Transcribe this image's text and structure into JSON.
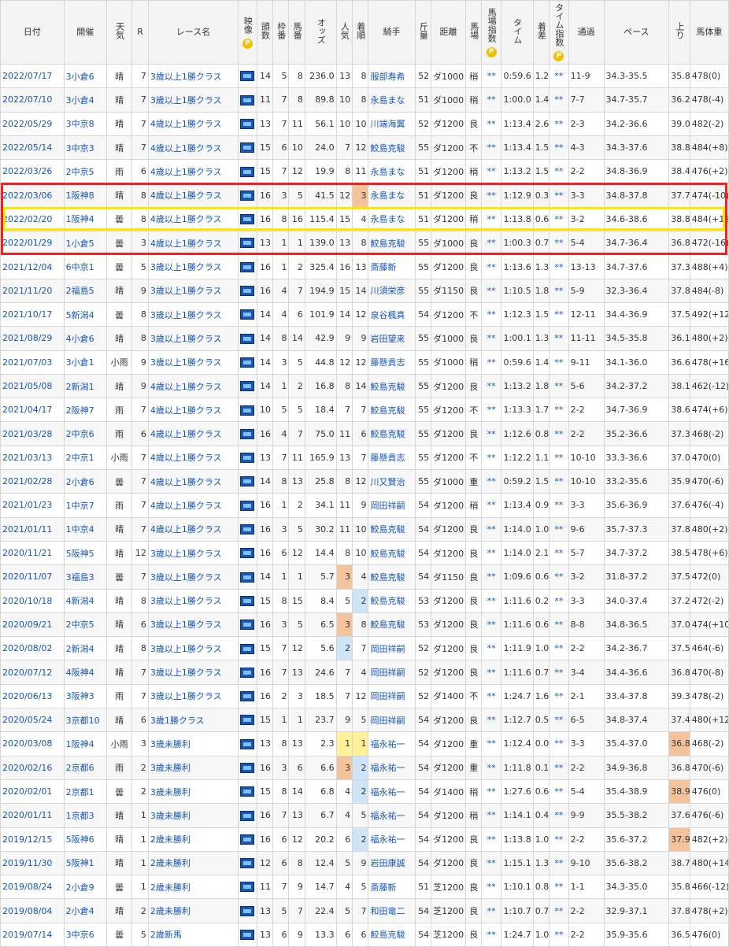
{
  "headers": [
    "日付",
    "開催",
    "天気",
    "R",
    "レース名",
    "映像",
    "頭数",
    "枠番",
    "馬番",
    "オッズ",
    "人気",
    "着順",
    "騎手",
    "斤量",
    "距離",
    "馬場",
    "馬場指数",
    "タイム",
    "着差",
    "タイム指数",
    "通過",
    "ペース",
    "上り",
    "馬体重"
  ],
  "p_badge": "P",
  "rows": [
    [
      "2022/07/17",
      "3小倉6",
      "晴",
      "7",
      "3歳以上1勝クラス",
      "14",
      "5",
      "8",
      "236.0",
      "13",
      "8",
      "服部寿希",
      "52",
      "ダ1000",
      "稍",
      "**",
      "0:59.6",
      "1.2",
      "**",
      "11-9",
      "34.3-35.5",
      "35.8",
      "478(0)"
    ],
    [
      "2022/07/10",
      "3小倉4",
      "晴",
      "7",
      "3歳以上1勝クラス",
      "11",
      "7",
      "8",
      "89.8",
      "10",
      "8",
      "永島まな",
      "51",
      "ダ1000",
      "稍",
      "**",
      "1:00.0",
      "1.4",
      "**",
      "7-7",
      "34.7-35.7",
      "36.2",
      "478(-4)"
    ],
    [
      "2022/05/29",
      "3中京8",
      "晴",
      "7",
      "4歳以上1勝クラス",
      "13",
      "7",
      "11",
      "56.1",
      "10",
      "10",
      "川端海翼",
      "52",
      "ダ1200",
      "良",
      "**",
      "1:13.4",
      "2.6",
      "**",
      "2-3",
      "34.2-36.6",
      "39.0",
      "482(-2)"
    ],
    [
      "2022/05/14",
      "3中京3",
      "晴",
      "7",
      "4歳以上1勝クラス",
      "15",
      "6",
      "10",
      "24.0",
      "7",
      "12",
      "鮫島克駿",
      "55",
      "ダ1200",
      "不",
      "**",
      "1:13.4",
      "1.5",
      "**",
      "4-3",
      "34.3-37.6",
      "38.8",
      "484(+8)"
    ],
    [
      "2022/03/26",
      "2中京5",
      "雨",
      "6",
      "4歳以上1勝クラス",
      "15",
      "7",
      "12",
      "19.9",
      "8",
      "11",
      "永島まな",
      "51",
      "ダ1200",
      "稍",
      "**",
      "1:13.2",
      "1.5",
      "**",
      "2-2",
      "34.8-36.9",
      "38.4",
      "476(+2)"
    ],
    [
      "2022/03/06",
      "1阪神8",
      "晴",
      "8",
      "4歳以上1勝クラス",
      "16",
      "3",
      "5",
      "41.5",
      "12",
      "3",
      "永島まな",
      "51",
      "ダ1200",
      "良",
      "**",
      "1:12.9",
      "0.3",
      "**",
      "3-3",
      "34.8-37.8",
      "37.7",
      "474(-10)"
    ],
    [
      "2022/02/20",
      "1阪神4",
      "曇",
      "8",
      "4歳以上1勝クラス",
      "16",
      "8",
      "16",
      "115.4",
      "15",
      "4",
      "永島まな",
      "51",
      "ダ1200",
      "稍",
      "**",
      "1:13.8",
      "0.6",
      "**",
      "3-2",
      "34.6-38.6",
      "38.8",
      "484(+12)"
    ],
    [
      "2022/01/29",
      "1小倉5",
      "曇",
      "3",
      "4歳以上1勝クラス",
      "13",
      "1",
      "1",
      "139.0",
      "13",
      "8",
      "鮫島克駿",
      "55",
      "ダ1000",
      "良",
      "**",
      "1:00.3",
      "0.7",
      "**",
      "5-4",
      "34.7-36.4",
      "36.8",
      "472(-16)"
    ],
    [
      "2021/12/04",
      "6中京1",
      "曇",
      "5",
      "3歳以上1勝クラス",
      "16",
      "1",
      "2",
      "325.4",
      "16",
      "13",
      "斎藤新",
      "55",
      "ダ1200",
      "良",
      "**",
      "1:13.6",
      "1.3",
      "**",
      "13-13",
      "34.7-37.6",
      "37.3",
      "488(+4)"
    ],
    [
      "2021/11/20",
      "2福島5",
      "晴",
      "9",
      "3歳以上1勝クラス",
      "16",
      "4",
      "7",
      "194.9",
      "15",
      "14",
      "川須栄彦",
      "55",
      "ダ1150",
      "良",
      "**",
      "1:10.5",
      "1.8",
      "**",
      "5-9",
      "32.3-36.4",
      "37.8",
      "484(-8)"
    ],
    [
      "2021/10/17",
      "5新潟4",
      "曇",
      "8",
      "3歳以上1勝クラス",
      "14",
      "4",
      "6",
      "101.9",
      "14",
      "12",
      "泉谷楓真",
      "54",
      "ダ1200",
      "不",
      "**",
      "1:12.3",
      "1.5",
      "**",
      "12-11",
      "34.4-36.9",
      "37.5",
      "492(+12)"
    ],
    [
      "2021/08/29",
      "4小倉6",
      "晴",
      "8",
      "3歳以上1勝クラス",
      "14",
      "8",
      "14",
      "42.9",
      "9",
      "9",
      "岩田望来",
      "55",
      "ダ1000",
      "良",
      "**",
      "1:00.1",
      "1.3",
      "**",
      "11-11",
      "34.5-35.8",
      "36.1",
      "480(+2)"
    ],
    [
      "2021/07/03",
      "3小倉1",
      "小雨",
      "9",
      "3歳以上1勝クラス",
      "14",
      "3",
      "5",
      "44.8",
      "12",
      "12",
      "藤懸貴志",
      "55",
      "ダ1000",
      "稍",
      "**",
      "0:59.6",
      "1.4",
      "**",
      "9-11",
      "34.1-36.0",
      "36.6",
      "478(+16)"
    ],
    [
      "2021/05/08",
      "2新潟1",
      "晴",
      "9",
      "4歳以上1勝クラス",
      "14",
      "1",
      "2",
      "16.8",
      "8",
      "14",
      "鮫島克駿",
      "55",
      "ダ1200",
      "良",
      "**",
      "1:13.2",
      "1.8",
      "**",
      "5-6",
      "34.2-37.2",
      "38.1",
      "462(-12)"
    ],
    [
      "2021/04/17",
      "2阪神7",
      "雨",
      "7",
      "4歳以上1勝クラス",
      "10",
      "5",
      "5",
      "18.4",
      "7",
      "7",
      "鮫島克駿",
      "55",
      "ダ1200",
      "不",
      "**",
      "1:13.3",
      "1.7",
      "**",
      "2-2",
      "34.7-36.9",
      "38.6",
      "474(+6)"
    ],
    [
      "2021/03/28",
      "2中京6",
      "雨",
      "6",
      "4歳以上1勝クラス",
      "16",
      "4",
      "7",
      "75.0",
      "11",
      "6",
      "鮫島克駿",
      "55",
      "ダ1200",
      "良",
      "**",
      "1:12.6",
      "0.8",
      "**",
      "2-2",
      "35.2-36.6",
      "37.3",
      "468(-2)"
    ],
    [
      "2021/03/13",
      "2中京1",
      "小雨",
      "7",
      "4歳以上1勝クラス",
      "13",
      "7",
      "11",
      "165.9",
      "13",
      "7",
      "藤懸貴志",
      "55",
      "ダ1200",
      "不",
      "**",
      "1:12.2",
      "1.1",
      "**",
      "10-10",
      "33.3-36.6",
      "37.0",
      "470(0)"
    ],
    [
      "2021/02/28",
      "2小倉6",
      "曇",
      "7",
      "4歳以上1勝クラス",
      "14",
      "8",
      "13",
      "25.8",
      "8",
      "12",
      "川又賢治",
      "55",
      "ダ1000",
      "重",
      "**",
      "0:59.2",
      "1.5",
      "**",
      "10-10",
      "33.2-35.6",
      "35.9",
      "470(-6)"
    ],
    [
      "2021/01/23",
      "1中京7",
      "雨",
      "7",
      "4歳以上1勝クラス",
      "16",
      "1",
      "2",
      "34.1",
      "11",
      "9",
      "岡田祥嗣",
      "54",
      "ダ1200",
      "稍",
      "**",
      "1:13.4",
      "0.9",
      "**",
      "3-3",
      "35.6-36.9",
      "37.6",
      "476(-4)"
    ],
    [
      "2021/01/11",
      "1中京4",
      "晴",
      "7",
      "4歳以上1勝クラス",
      "16",
      "3",
      "5",
      "30.2",
      "11",
      "10",
      "鮫島克駿",
      "54",
      "ダ1200",
      "良",
      "**",
      "1:14.0",
      "1.0",
      "**",
      "9-6",
      "35.7-37.3",
      "37.8",
      "480(+2)"
    ],
    [
      "2020/11/21",
      "5阪神5",
      "晴",
      "12",
      "3歳以上1勝クラス",
      "16",
      "6",
      "12",
      "14.4",
      "8",
      "10",
      "鮫島克駿",
      "54",
      "ダ1200",
      "良",
      "**",
      "1:14.0",
      "2.1",
      "**",
      "5-7",
      "34.7-37.2",
      "38.5",
      "478(+6)"
    ],
    [
      "2020/11/07",
      "3福島3",
      "曇",
      "7",
      "3歳以上1勝クラス",
      "14",
      "1",
      "1",
      "5.7",
      "3",
      "4",
      "鮫島克駿",
      "54",
      "ダ1150",
      "良",
      "**",
      "1:09.6",
      "0.6",
      "**",
      "3-2",
      "31.8-37.2",
      "37.5",
      "472(0)"
    ],
    [
      "2020/10/18",
      "4新潟4",
      "晴",
      "8",
      "3歳以上1勝クラス",
      "15",
      "8",
      "15",
      "8.4",
      "5",
      "2",
      "鮫島克駿",
      "53",
      "ダ1200",
      "良",
      "**",
      "1:11.6",
      "0.2",
      "**",
      "3-3",
      "34.0-37.4",
      "37.2",
      "472(-2)"
    ],
    [
      "2020/09/21",
      "2中京5",
      "晴",
      "6",
      "3歳以上1勝クラス",
      "16",
      "3",
      "5",
      "6.5",
      "3",
      "8",
      "鮫島克駿",
      "53",
      "ダ1200",
      "良",
      "**",
      "1:11.6",
      "0.6",
      "**",
      "8-8",
      "34.8-36.5",
      "37.0",
      "474(+10)"
    ],
    [
      "2020/08/02",
      "2新潟4",
      "晴",
      "8",
      "3歳以上1勝クラス",
      "15",
      "7",
      "12",
      "5.6",
      "2",
      "7",
      "岡田祥嗣",
      "52",
      "ダ1200",
      "良",
      "**",
      "1:11.9",
      "1.0",
      "**",
      "2-2",
      "34.2-36.7",
      "37.5",
      "464(-6)"
    ],
    [
      "2020/07/12",
      "4阪神4",
      "晴",
      "7",
      "3歳以上1勝クラス",
      "16",
      "7",
      "13",
      "24.6",
      "7",
      "4",
      "岡田祥嗣",
      "52",
      "ダ1200",
      "良",
      "**",
      "1:11.6",
      "0.7",
      "**",
      "3-4",
      "34.4-36.6",
      "36.8",
      "470(-8)"
    ],
    [
      "2020/06/13",
      "3阪神3",
      "雨",
      "7",
      "3歳以上1勝クラス",
      "16",
      "2",
      "3",
      "18.5",
      "7",
      "12",
      "岡田祥嗣",
      "52",
      "ダ1400",
      "不",
      "**",
      "1:24.7",
      "1.6",
      "**",
      "2-1",
      "33.4-37.8",
      "39.3",
      "478(-2)"
    ],
    [
      "2020/05/24",
      "3京都10",
      "晴",
      "6",
      "3歳1勝クラス",
      "15",
      "1",
      "1",
      "23.7",
      "9",
      "5",
      "岡田祥嗣",
      "54",
      "ダ1200",
      "良",
      "**",
      "1:12.7",
      "0.5",
      "**",
      "6-5",
      "34.8-37.4",
      "37.4",
      "480(+12)"
    ],
    [
      "2020/03/08",
      "1阪神4",
      "小雨",
      "3",
      "3歳未勝利",
      "13",
      "8",
      "13",
      "2.3",
      "1",
      "1",
      "福永祐一",
      "54",
      "ダ1200",
      "重",
      "**",
      "1:12.4",
      "0.0",
      "**",
      "3-3",
      "35.4-37.0",
      "36.8",
      "468(-2)"
    ],
    [
      "2020/02/16",
      "2京都6",
      "雨",
      "2",
      "3歳未勝利",
      "16",
      "3",
      "6",
      "6.6",
      "3",
      "2",
      "福永祐一",
      "54",
      "ダ1200",
      "重",
      "**",
      "1:11.8",
      "0.1",
      "**",
      "2-2",
      "34.9-36.8",
      "36.8",
      "470(-6)"
    ],
    [
      "2020/02/01",
      "2京都1",
      "曇",
      "2",
      "3歳未勝利",
      "15",
      "8",
      "14",
      "6.8",
      "4",
      "2",
      "福永祐一",
      "54",
      "ダ1400",
      "稍",
      "**",
      "1:27.6",
      "0.6",
      "**",
      "5-4",
      "35.4-38.9",
      "38.9",
      "476(0)"
    ],
    [
      "2020/01/11",
      "1京都3",
      "晴",
      "1",
      "3歳未勝利",
      "16",
      "7",
      "13",
      "6.7",
      "4",
      "5",
      "福永祐一",
      "54",
      "ダ1200",
      "稍",
      "**",
      "1:14.1",
      "0.4",
      "**",
      "9-9",
      "35.5-38.2",
      "37.6",
      "476(-6)"
    ],
    [
      "2019/12/15",
      "5阪神6",
      "晴",
      "1",
      "2歳未勝利",
      "16",
      "6",
      "12",
      "20.2",
      "6",
      "2",
      "福永祐一",
      "54",
      "ダ1200",
      "良",
      "**",
      "1:13.8",
      "1.0",
      "**",
      "2-2",
      "35.6-37.2",
      "37.9",
      "482(+2)"
    ],
    [
      "2019/11/30",
      "5阪神1",
      "晴",
      "1",
      "2歳未勝利",
      "12",
      "6",
      "8",
      "12.4",
      "5",
      "9",
      "岩田康誠",
      "54",
      "ダ1200",
      "良",
      "**",
      "1:15.1",
      "1.3",
      "**",
      "9-10",
      "35.6-38.2",
      "38.7",
      "480(+14)"
    ],
    [
      "2019/08/24",
      "2小倉9",
      "曇",
      "1",
      "2歳未勝利",
      "11",
      "7",
      "9",
      "14.7",
      "4",
      "5",
      "斎藤新",
      "51",
      "芝1200",
      "良",
      "**",
      "1:10.1",
      "0.8",
      "**",
      "1-1",
      "34.3-35.0",
      "35.8",
      "466(-12)"
    ],
    [
      "2019/08/04",
      "2小倉4",
      "晴",
      "2",
      "2歳未勝利",
      "13",
      "5",
      "7",
      "22.4",
      "5",
      "7",
      "和田竜二",
      "54",
      "芝1200",
      "良",
      "**",
      "1:10.7",
      "0.7",
      "**",
      "2-2",
      "32.9-37.1",
      "37.8",
      "478(+2)"
    ],
    [
      "2019/07/14",
      "3中京6",
      "曇",
      "5",
      "2歳新馬",
      "13",
      "6",
      "9",
      "13.3",
      "6",
      "6",
      "鮫島克駿",
      "54",
      "芝1200",
      "良",
      "**",
      "1:24.7",
      "1.0",
      "**",
      "2-2",
      "35.9-35.6",
      "36.5",
      "476(0)"
    ]
  ],
  "highlights": {
    "orange_pop_rows": [
      21,
      23,
      29
    ],
    "yellow_pop_rows": [
      28
    ],
    "blue_pop_rows": [
      24
    ],
    "orange_rank_rows": [
      5
    ],
    "yellow_rank_rows": [
      28
    ],
    "blue_rank_rows": [
      22,
      29,
      30,
      32
    ],
    "orange_agari_rows": [
      28,
      30,
      32
    ],
    "colors": {
      "link": "#1656b8",
      "red_box": "#e22222",
      "yellow_box": "#ffe800",
      "orange": "#f3c49b",
      "yellow": "#fff09a",
      "blue": "#cfe4f7"
    }
  }
}
